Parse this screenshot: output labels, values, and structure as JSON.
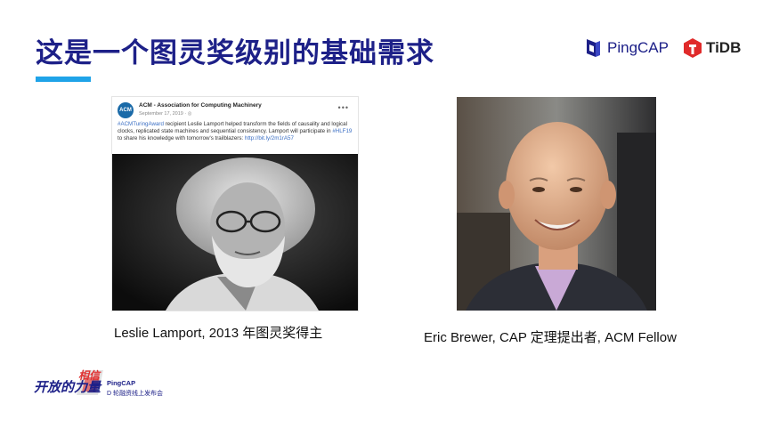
{
  "slide": {
    "title": "这是一个图灵奖级别的基础需求",
    "accent_color": "#1fa3e8",
    "title_color": "#1d2088"
  },
  "logos": {
    "pingcap": "PingCAP",
    "tidb": "TiDB",
    "pingcap_icon": "pingcap-logo-icon",
    "tidb_icon": "tidb-logo-icon"
  },
  "acm_post": {
    "account": "ACM - Association for Computing Machinery",
    "avatar_text": "ACM",
    "date": "September 17, 2019 · ",
    "hashtag": "#ACMTuringAward",
    "text_1": " recipient Leslie Lamport helped transform the fields of causality and logical clocks, replicated state machines and sequential consistency. Lamport will participate in ",
    "hashtag_2": "#HLF19",
    "text_2": " to share his knowledge with tomorrow's trailblazers: ",
    "link": "http://bit.ly/2m1rA57",
    "more_icon": "more-options-icon"
  },
  "captions": {
    "left": "Leslie Lamport, 2013 年图灵奖得主",
    "right": "Eric Brewer, CAP 定理提出者, ACM Fellow"
  },
  "footer": {
    "logo_text": "开放的力量 相信",
    "line1": "PingCAP",
    "line2": "D 轮融资线上发布会"
  }
}
